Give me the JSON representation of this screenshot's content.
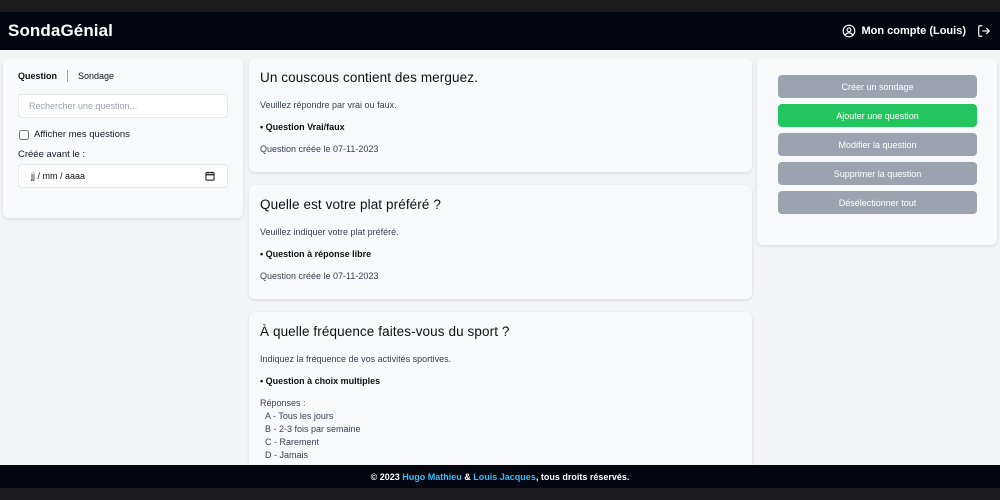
{
  "navbar": {
    "brand": "SondaGénial",
    "account_label": "Mon compte (Louis)",
    "account_icon": "user-circle-icon",
    "logout_icon": "logout-icon"
  },
  "filters": {
    "tab_question": "Question",
    "tab_sondage": "Sondage",
    "search_placeholder": "Rechercher une question...",
    "show_mine_label": "Afficher mes questions",
    "show_mine_checked": false,
    "created_before_label": "Créée avant le :",
    "date_placeholder": "jj / mm / aaaa"
  },
  "questions": [
    {
      "title": "Un couscous contient des merguez.",
      "description": "Veuillez répondre par vrai ou faux.",
      "type": "• Question Vrai/faux",
      "created": "Question créée le 07-11-2023"
    },
    {
      "title": "Quelle est votre plat préféré ?",
      "description": "Veuillez indiquer votre plat préféré.",
      "type": "• Question à réponse libre",
      "created": "Question créée le 07-11-2023"
    },
    {
      "title": "À quelle fréquence faites-vous du sport ?",
      "description": "Indiquez la fréquence de vos activités sportives.",
      "type": "• Question à choix multiples",
      "answers_label": "Réponses :",
      "answers": [
        "A - Tous les jours",
        "B - 2-3 fois par semaine",
        "C - Rarement",
        "D - Jamais"
      ]
    }
  ],
  "actions": {
    "create_survey": "Créer un sondage",
    "add_question": "Ajouter une question",
    "edit_question": "Modifier la question",
    "delete_question": "Supprimer la question",
    "deselect_all": "Désélectionner tout"
  },
  "footer": {
    "prefix": "© 2023 ",
    "author1": "Hugo Mathieu",
    "and": " & ",
    "author2": "Louis Jacques",
    "suffix": ", tous droits réservés."
  },
  "colors": {
    "navbar_bg": "#03060f",
    "primary_button": "#22c55e",
    "secondary_button": "#9ca3af",
    "footer_link": "#38bdf8"
  }
}
